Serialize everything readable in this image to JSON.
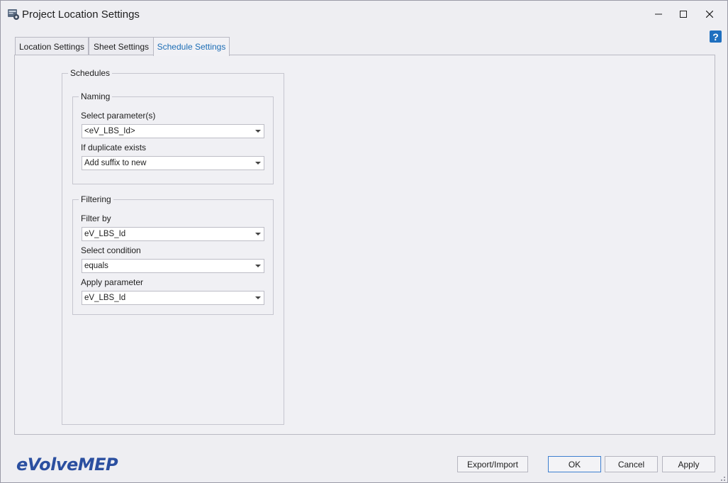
{
  "window": {
    "title": "Project Location Settings",
    "icons": {
      "app": "settings-app-icon",
      "minimize": "minimize-icon",
      "maximize": "maximize-icon",
      "close": "close-icon"
    }
  },
  "help": {
    "label": "?"
  },
  "tabs": [
    {
      "label": "Location Settings",
      "active": false
    },
    {
      "label": "Sheet Settings",
      "active": false
    },
    {
      "label": "Schedule Settings",
      "active": true
    }
  ],
  "schedules": {
    "group_label": "Schedules",
    "naming": {
      "group_label": "Naming",
      "select_parameters_label": "Select parameter(s)",
      "select_parameters_value": "<eV_LBS_Id>",
      "duplicate_label": "If duplicate exists",
      "duplicate_value": "Add suffix to new"
    },
    "filtering": {
      "group_label": "Filtering",
      "filter_by_label": "Filter by",
      "filter_by_value": "eV_LBS_Id",
      "condition_label": "Select condition",
      "condition_value": "equals",
      "apply_parameter_label": "Apply parameter",
      "apply_parameter_value": "eV_LBS_Id"
    }
  },
  "footer": {
    "logo_text": "eVolveMEP",
    "export_import_label": "Export/Import",
    "ok_label": "OK",
    "cancel_label": "Cancel",
    "apply_label": "Apply"
  },
  "colors": {
    "accent": "#1c6db5",
    "logo": "#2b4fa0",
    "window_bg": "#eeeef2",
    "help_bg": "#1f6fbf"
  }
}
